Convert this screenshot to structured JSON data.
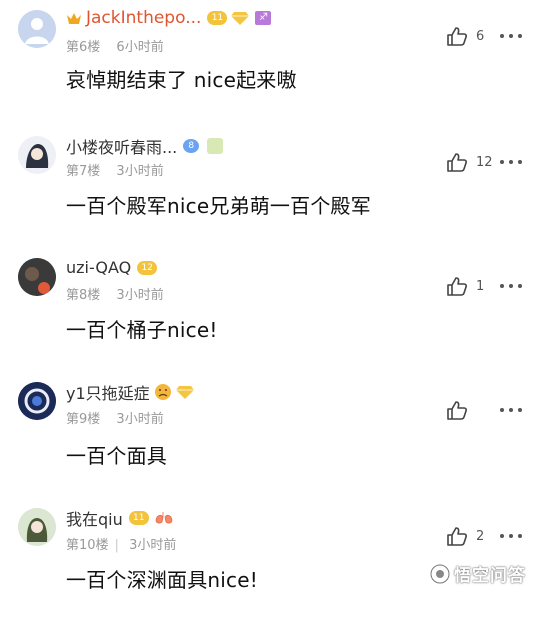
{
  "comments": [
    {
      "username": "JackInthepo...",
      "level": "11",
      "floor": "第6楼",
      "time": "6小时前",
      "content": "哀悼期结束了 nice起来嗷",
      "likes": "6",
      "vip": true
    },
    {
      "username": "小楼夜听春雨...",
      "level": "8",
      "floor": "第7楼",
      "time": "3小时前",
      "content": "一百个殿军nice兄弟萌一百个殿军",
      "likes": "12",
      "vip": false
    },
    {
      "username": "uzi-QAQ",
      "level": "12",
      "floor": "第8楼",
      "time": "3小时前",
      "content": "一百个桶子nice!",
      "likes": "1",
      "vip": false
    },
    {
      "username": "y1只拖延症",
      "level": "",
      "floor": "第9楼",
      "time": "3小时前",
      "content": "一百个面具",
      "likes": "",
      "vip": false
    },
    {
      "username": "我在qiu",
      "level": "11",
      "floor": "第10楼",
      "time": "3小时前",
      "content": "一百个深渊面具nice!",
      "likes": "2",
      "vip": false
    }
  ],
  "watermark": {
    "text": "悟空问答"
  },
  "colors": {
    "vip_name": "#e2542f",
    "meta": "#999999",
    "badge_gold": "#f2c33b",
    "badge_blue": "#6aa3f2"
  },
  "icons": {
    "like": "thumbs-up-icon",
    "more": "more-dots-icon"
  }
}
